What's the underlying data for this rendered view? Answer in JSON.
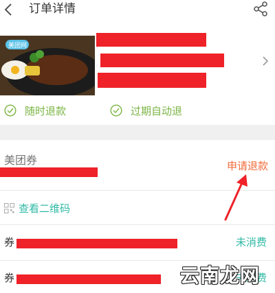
{
  "header": {
    "title": "订单详情",
    "back_icon": "chevron-left-icon",
    "share_icon": "share-icon"
  },
  "deal": {
    "image_badge": "美团网",
    "chevron_icon": "chevron-right-icon"
  },
  "badges": [
    {
      "label": "随时退款",
      "icon": "check-circle-icon"
    },
    {
      "label": "过期自动退",
      "icon": "check-circle-icon"
    }
  ],
  "coupon": {
    "label": "美团券",
    "refund_button": "申请退款",
    "qr_link": "查看二维码",
    "codes": [
      {
        "prefix": "券",
        "status": "未消费"
      },
      {
        "prefix": "券",
        "status": "未消费"
      }
    ]
  },
  "watermark": {
    "text": "云南龙网"
  },
  "colors": {
    "accent_green": "#7bb544",
    "teal": "#2fb9a5",
    "orange": "#f26b3a",
    "redaction": "#ee2228"
  }
}
